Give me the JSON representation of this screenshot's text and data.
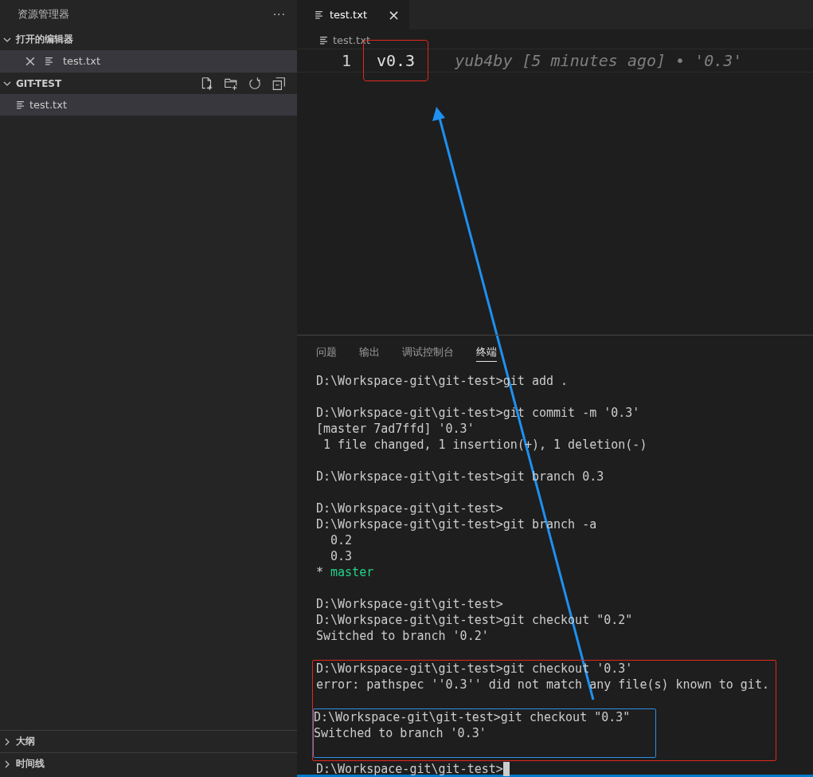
{
  "sidebar": {
    "title": "资源管理器",
    "more": "···",
    "sections": [
      {
        "title": "打开的编辑器",
        "expanded": true,
        "items": [
          {
            "label": "test.txt",
            "closable": true,
            "selected": true
          }
        ]
      },
      {
        "title": "GIT-TEST",
        "expanded": true,
        "items": [
          {
            "label": "test.txt",
            "closable": false,
            "selected": true
          }
        ]
      }
    ],
    "bottom_sections": [
      {
        "title": "大纲",
        "expanded": false
      },
      {
        "title": "时间线",
        "expanded": false
      }
    ]
  },
  "editor": {
    "tabs": [
      {
        "label": "test.txt",
        "close": "×",
        "selected": true
      }
    ],
    "breadcrumb": "test.txt",
    "lines": [
      {
        "number": "1",
        "code": "v0.3",
        "blame": "yub4by [5 minutes ago] • '0.3'",
        "marked": true
      }
    ]
  },
  "panel": {
    "tabs": [
      {
        "label": "问题",
        "selected": false
      },
      {
        "label": "输出",
        "selected": false
      },
      {
        "label": "调试控制台",
        "selected": false
      },
      {
        "label": "终端",
        "selected": true
      }
    ],
    "terminal": [
      {
        "kind": "line",
        "text": "D:\\Workspace-git\\git-test>git add ."
      },
      {
        "kind": "blank"
      },
      {
        "kind": "line",
        "text": "D:\\Workspace-git\\git-test>git commit -m '0.3'"
      },
      {
        "kind": "line",
        "text": "[master 7ad7ffd] '0.3'"
      },
      {
        "kind": "line",
        "text": " 1 file changed, 1 insertion(+), 1 deletion(-)"
      },
      {
        "kind": "blank"
      },
      {
        "kind": "line",
        "text": "D:\\Workspace-git\\git-test>git branch 0.3"
      },
      {
        "kind": "blank"
      },
      {
        "kind": "line",
        "text": "D:\\Workspace-git\\git-test>"
      },
      {
        "kind": "line",
        "text": "D:\\Workspace-git\\git-test>git branch -a"
      },
      {
        "kind": "line",
        "text": "  0.2"
      },
      {
        "kind": "line",
        "text": "  0.3"
      },
      {
        "kind": "branch",
        "marker": "*",
        "text": "master"
      },
      {
        "kind": "blank"
      },
      {
        "kind": "line",
        "text": "D:\\Workspace-git\\git-test>"
      },
      {
        "kind": "line",
        "text": "D:\\Workspace-git\\git-test>git checkout \"0.2\""
      },
      {
        "kind": "line",
        "text": "Switched to branch '0.2'"
      },
      {
        "kind": "blank"
      },
      {
        "kind": "frame",
        "color": "#e0281e",
        "children": [
          {
            "kind": "line",
            "text": "D:\\Workspace-git\\git-test>git checkout '0.3'"
          },
          {
            "kind": "line",
            "text": "error: pathspec ''0.3'' did not match any file(s) known to git."
          },
          {
            "kind": "blank"
          },
          {
            "kind": "frame",
            "color": "#2d8ee6",
            "children": [
              {
                "kind": "line",
                "text": "D:\\Workspace-git\\git-test>git checkout \"0.3\""
              },
              {
                "kind": "line",
                "text": "Switched to branch '0.3'"
              },
              {
                "kind": "blank"
              }
            ]
          }
        ]
      },
      {
        "kind": "cursor",
        "text": "D:\\Workspace-git\\git-test>"
      }
    ]
  }
}
